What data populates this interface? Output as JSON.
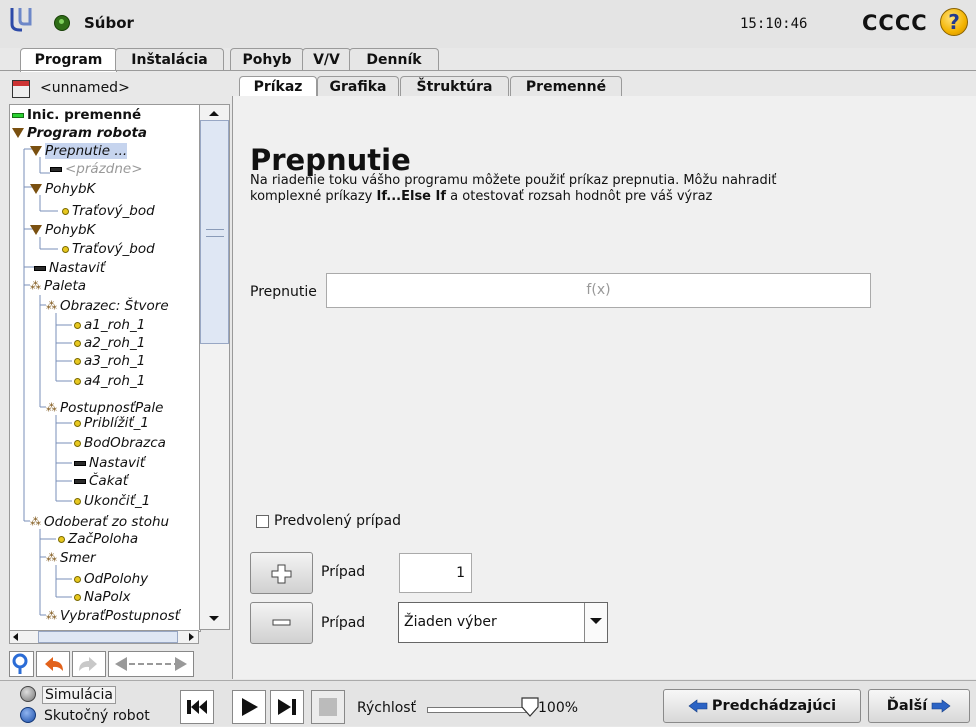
{
  "header": {
    "file_label": "Súbor",
    "clock": "15:10:46",
    "robot_name": "CCCC",
    "help_glyph": "?"
  },
  "main_tabs": [
    "Program",
    "Inštalácia",
    "Pohyb",
    "V/V",
    "Denník"
  ],
  "program_name": "<unnamed>",
  "tree": [
    {
      "label": "Inic. premenné",
      "icon": "green-command-icon"
    },
    {
      "label": "Program robota",
      "icon": "folder-triangle-icon"
    },
    {
      "label": "Prepnutie ...",
      "icon": "folder-triangle-icon"
    },
    {
      "label": "<prázdne>",
      "icon": "command-icon"
    },
    {
      "label": "PohybK",
      "icon": "folder-triangle-icon"
    },
    {
      "label": "Traťový_bod",
      "icon": "waypoint-icon"
    },
    {
      "label": "PohybK",
      "icon": "folder-triangle-icon"
    },
    {
      "label": "Traťový_bod",
      "icon": "waypoint-icon"
    },
    {
      "label": "Nastaviť",
      "icon": "command-icon"
    },
    {
      "label": "Paleta",
      "icon": "pallet-icon"
    },
    {
      "label": "Obrazec: Štvore",
      "icon": "pallet-icon"
    },
    {
      "label": "a1_roh_1",
      "icon": "waypoint-icon"
    },
    {
      "label": "a2_roh_1",
      "icon": "waypoint-icon"
    },
    {
      "label": "a3_roh_1",
      "icon": "waypoint-icon"
    },
    {
      "label": "a4_roh_1",
      "icon": "waypoint-icon"
    },
    {
      "label": "PostupnosťPale",
      "icon": "pallet-icon"
    },
    {
      "label": "Priblížiť_1",
      "icon": "waypoint-icon"
    },
    {
      "label": "BodObrazca",
      "icon": "waypoint-icon"
    },
    {
      "label": "Nastaviť",
      "icon": "command-icon"
    },
    {
      "label": "Čakať",
      "icon": "command-icon"
    },
    {
      "label": "Ukončiť_1",
      "icon": "waypoint-icon"
    },
    {
      "label": "Odoberať zo stohu",
      "icon": "pallet-icon"
    },
    {
      "label": "ZačPoloha",
      "icon": "waypoint-icon"
    },
    {
      "label": "Smer",
      "icon": "pallet-icon"
    },
    {
      "label": "OdPolohy",
      "icon": "waypoint-icon"
    },
    {
      "label": "NaPolx",
      "icon": "waypoint-icon"
    },
    {
      "label": "VybraťPostupnosť",
      "icon": "pallet-icon"
    }
  ],
  "right_tabs": [
    "Príkaz",
    "Grafika",
    "Štruktúra",
    "Premenné"
  ],
  "content": {
    "heading": "Prepnutie",
    "desc_line1": "Na riadenie toku vášho programu môžete použiť príkaz prepnutia. Môžu nahradiť",
    "desc_line2_pre": "komplexné príkazy ",
    "desc_line2_bold": "If...Else If",
    "desc_line2_post": " a otestovať rozsah hodnôt pre váš výraz",
    "switch_label": "Prepnutie",
    "switch_placeholder": "f(x)",
    "default_case_label": "Predvolený prípad",
    "case_label": "Prípad",
    "case_value": "1",
    "case_select_value": "Žiaden výber"
  },
  "bottom": {
    "simulation": "Simulácia",
    "real_robot": "Skutočný robot",
    "speed_label": "Rýchlosť",
    "speed_value": "100%",
    "speed_fraction": 1.0,
    "prev_label": "Predchádzajúci",
    "next_label": "Ďalší"
  }
}
